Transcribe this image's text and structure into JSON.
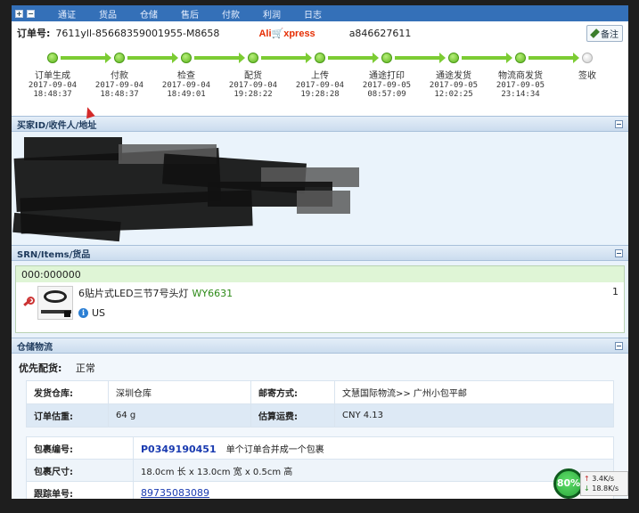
{
  "top_nav": {
    "items": [
      "通证",
      "货品",
      "仓储",
      "售后",
      "付款",
      "利润",
      "日志"
    ]
  },
  "order": {
    "order_label": "订单号:",
    "order_no": "7611yll-85668359001955-M8658",
    "platform_logo": "AliExpress",
    "buyer_account": "a846627611",
    "note_button": "备注"
  },
  "progress": {
    "steps": [
      {
        "name": "订单生成",
        "date": "2017-09-04",
        "time": "18:48:37",
        "done": true
      },
      {
        "name": "付款",
        "date": "2017-09-04",
        "time": "18:48:37",
        "done": true
      },
      {
        "name": "检查",
        "date": "2017-09-04",
        "time": "18:49:01",
        "done": true
      },
      {
        "name": "配货",
        "date": "2017-09-04",
        "time": "19:28:22",
        "done": true
      },
      {
        "name": "上传",
        "date": "2017-09-04",
        "time": "19:28:28",
        "done": true
      },
      {
        "name": "通途打印",
        "date": "2017-09-05",
        "time": "08:57:09",
        "done": true
      },
      {
        "name": "通途发货",
        "date": "2017-09-05",
        "time": "12:02:25",
        "done": true
      },
      {
        "name": "物流商发货",
        "date": "2017-09-05",
        "time": "23:14:34",
        "done": true
      },
      {
        "name": "签收",
        "date": "",
        "time": "",
        "done": false
      }
    ]
  },
  "buyer_panel": {
    "title": "买家ID/收件人/地址"
  },
  "items_panel": {
    "title": "SRN/Items/货品",
    "code": "000:000000",
    "item": {
      "title": "6贴片式LED三节7号头灯",
      "sku": "WY6631",
      "country": "US",
      "qty": "1"
    }
  },
  "warehouse_panel": {
    "title": "仓储物流",
    "priority_label": "优先配货:",
    "priority_value": "正常",
    "shipping_rows": [
      {
        "k1": "发货仓库:",
        "v1": "深圳仓库",
        "k2": "邮寄方式:",
        "v2": "文慧国际物流>> 广州小包平邮"
      },
      {
        "k1": "订单估重:",
        "v1": "64 g",
        "k2": "估算运费:",
        "v2": "CNY 4.13"
      }
    ],
    "package": {
      "no_label": "包裹编号:",
      "no_value": "P0349190451",
      "no_note": "单个订单合并成一个包裹",
      "size_label": "包裹尺寸:",
      "size_value": "18.0cm 长 x 13.0cm 宽 x 0.5cm 高",
      "tracking_label": "跟踪单号:",
      "tracking_value": "89735083089"
    }
  },
  "speed_widget": {
    "percent": "80%",
    "upload": "3.4K/s",
    "download": "18.8K/s"
  },
  "colors": {
    "accent": "#3470b8",
    "progress_green": "#7ccc33",
    "link_blue": "#1a3bb0"
  }
}
